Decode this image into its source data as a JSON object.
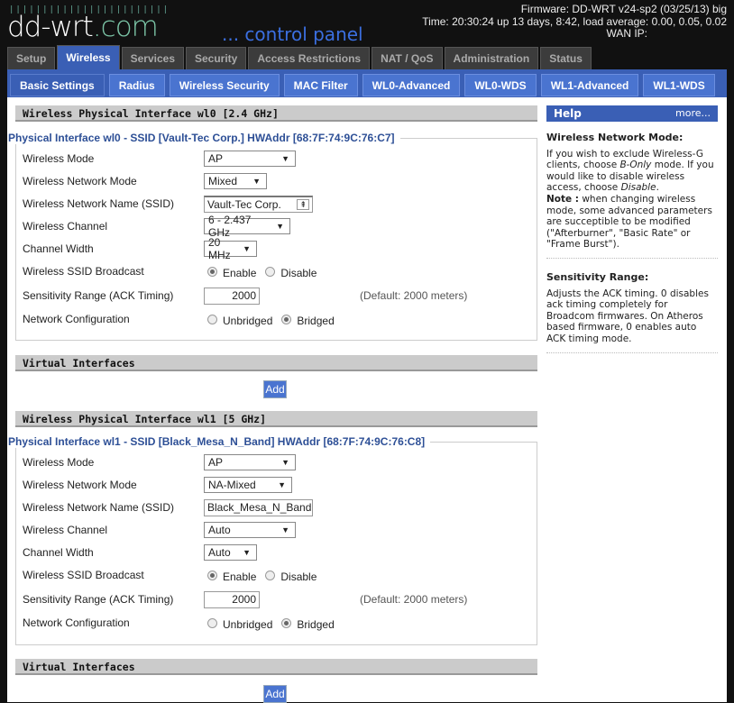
{
  "header": {
    "logo_text": "dd-wrt",
    "logo_suffix": ".com",
    "tagline": "... control panel",
    "firmware": "Firmware: DD-WRT v24-sp2 (03/25/13) big",
    "time": "Time: 20:30:24 up 13 days, 8:42, load average: 0.00, 0.05, 0.02",
    "wan_ip": "WAN IP:"
  },
  "tabs": [
    "Setup",
    "Wireless",
    "Services",
    "Security",
    "Access Restrictions",
    "NAT / QoS",
    "Administration",
    "Status"
  ],
  "active_tab": "Wireless",
  "subtabs": [
    "Basic Settings",
    "Radius",
    "Wireless Security",
    "MAC Filter",
    "WL0-Advanced",
    "WL0-WDS",
    "WL1-Advanced",
    "WL1-WDS"
  ],
  "active_subtab": "Basic Settings",
  "labels": {
    "mode": "Wireless Mode",
    "netmode": "Wireless Network Mode",
    "ssid": "Wireless Network Name (SSID)",
    "channel": "Wireless Channel",
    "width": "Channel Width",
    "broadcast": "Wireless SSID Broadcast",
    "enable": "Enable",
    "disable": "Disable",
    "ack": "Sensitivity Range (ACK Timing)",
    "netconf": "Network Configuration",
    "unbridged": "Unbridged",
    "bridged": "Bridged",
    "virtual": "Virtual Interfaces",
    "add": "Add"
  },
  "wl0": {
    "title": "Wireless Physical Interface wl0 [2.4 GHz]",
    "legend": "Physical Interface wl0 - SSID [Vault-Tec Corp.] HWAddr [68:7F:74:9C:76:C7]",
    "mode": "AP",
    "netmode": "Mixed",
    "ssid": "Vault-Tec Corp.",
    "channel": "6 - 2.437 GHz",
    "width": "20 MHz",
    "broadcast": "Enable",
    "ack": "2000",
    "ack_default": "(Default: 2000 meters)",
    "netconf": "Bridged"
  },
  "wl1": {
    "title": "Wireless Physical Interface wl1 [5 GHz]",
    "legend": "Physical Interface wl1 - SSID [Black_Mesa_N_Band] HWAddr [68:7F:74:9C:76:C8]",
    "mode": "AP",
    "netmode": "NA-Mixed",
    "ssid": "Black_Mesa_N_Band",
    "channel": "Auto",
    "width": "Auto",
    "broadcast": "Enable",
    "ack": "2000",
    "ack_default": "(Default: 2000 meters)",
    "netconf": "Bridged"
  },
  "help": {
    "title": "Help",
    "more": "more...",
    "s1_title": "Wireless Network Mode:",
    "s1_a": "If you wish to exclude Wireless-G clients, choose ",
    "s1_b": "B-Only",
    "s1_c": " mode. If you would like to disable wireless access, choose ",
    "s1_d": "Disable",
    "s1_e": ".",
    "s1_note": "Note :",
    "s1_f": " when changing wireless mode, some advanced parameters are succeptible to be modified (\"Afterburner\", \"Basic Rate\" or \"Frame Burst\").",
    "s2_title": "Sensitivity Range:",
    "s2_text": "Adjusts the ACK timing. 0 disables ack timing completely for Broadcom firmwares. On Atheros based firmware, 0 enables auto ACK timing mode."
  },
  "colors": {
    "accent": "#3a5fb5",
    "subtab": "#4a74d0",
    "legend": "#2d4f96"
  }
}
